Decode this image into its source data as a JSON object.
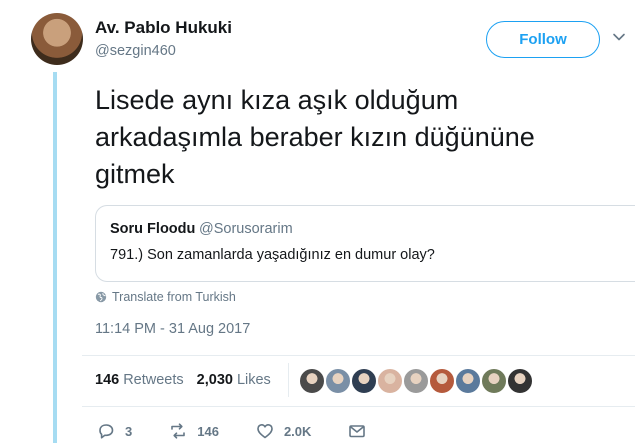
{
  "author": {
    "name": "Av. Pablo Hukuki",
    "handle": "@sezgin460"
  },
  "follow_label": "Follow",
  "tweet": {
    "line1": "Lisede aynı kıza aşık olduğum",
    "line2": "arkadaşımla beraber kızın düğününe",
    "line3": "gitmek"
  },
  "quote": {
    "name": "Soru Floodu",
    "handle": "@Sorusorarim",
    "text": "791.) Son zamanlarda yaşadığınız en dumur olay?"
  },
  "translate_label": "Translate from Turkish",
  "timestamp": "11:14 PM - 31 Aug 2017",
  "stats": {
    "retweets_count": "146",
    "retweets_label": "Retweets",
    "likes_count": "2,030",
    "likes_label": "Likes"
  },
  "likers": [
    {
      "icon": "liker-avatar",
      "color": "#4a4a4a"
    },
    {
      "icon": "liker-avatar",
      "color": "#7a8fa6"
    },
    {
      "icon": "liker-avatar",
      "color": "#2f3e52"
    },
    {
      "icon": "liker-avatar",
      "color": "#d9b3a0"
    },
    {
      "icon": "liker-avatar",
      "color": "#9a9a9a"
    },
    {
      "icon": "liker-avatar",
      "color": "#b55a3c"
    },
    {
      "icon": "liker-avatar",
      "color": "#5b7a9c"
    },
    {
      "icon": "liker-avatar",
      "color": "#6f7a5a"
    },
    {
      "icon": "liker-avatar",
      "color": "#333333"
    }
  ],
  "actions": {
    "reply_count": "3",
    "retweet_count": "146",
    "like_count": "2.0K"
  },
  "colors": {
    "accent": "#1da1f2",
    "thread_line": "#a6dcf2",
    "secondary_text": "#657786"
  }
}
